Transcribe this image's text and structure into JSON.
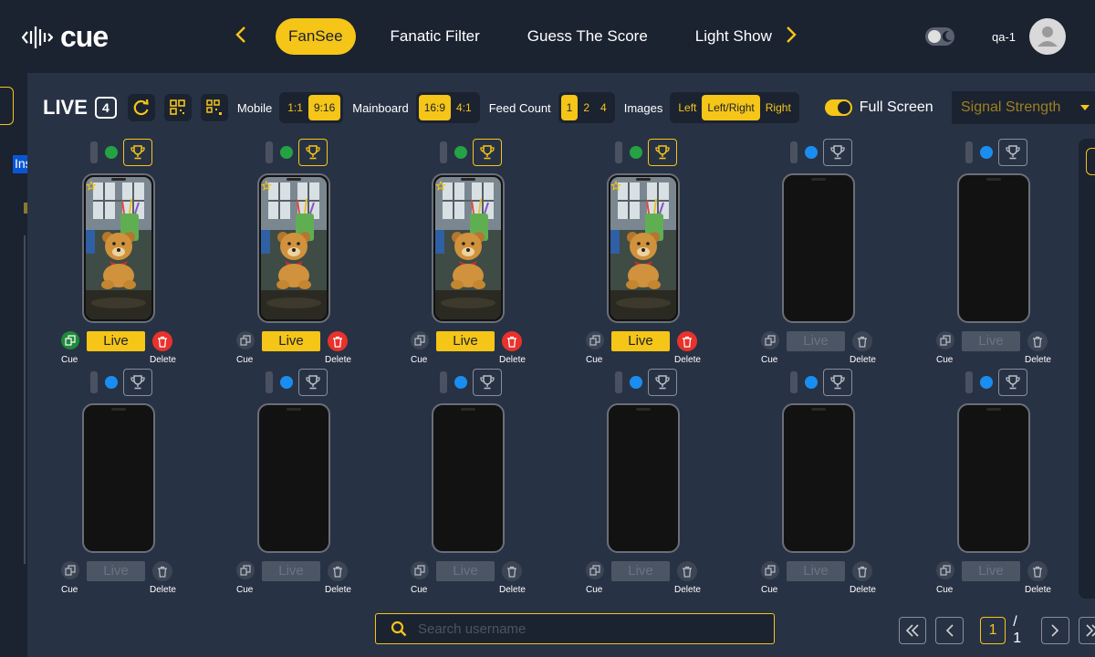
{
  "app": {
    "logo_text": "cue"
  },
  "nav": {
    "tabs": [
      {
        "label": "FanSee",
        "active": true
      },
      {
        "label": "Fanatic Filter",
        "active": false
      },
      {
        "label": "Guess The Score",
        "active": false
      },
      {
        "label": "Light Show",
        "active": false
      }
    ],
    "prev_icon": "chevron-left-icon",
    "next_icon": "chevron-right-icon"
  },
  "user": {
    "name": "qa-1",
    "avatar_icon": "user-avatar-icon",
    "theme_icon": "moon-icon"
  },
  "sidebar": {
    "selected_label": "Ins"
  },
  "toolbar": {
    "title": "LIVE",
    "count": "4",
    "mobile_label": "Mobile",
    "mobile_options": [
      {
        "label": "1:1",
        "active": false
      },
      {
        "label": "9:16",
        "active": true
      }
    ],
    "mainboard_label": "Mainboard",
    "mainboard_options": [
      {
        "label": "16:9",
        "active": true
      },
      {
        "label": "4:1",
        "active": false
      }
    ],
    "feed_count_label": "Feed Count",
    "feed_count_options": [
      {
        "label": "1",
        "active": true
      },
      {
        "label": "2",
        "active": false
      },
      {
        "label": "4",
        "active": false
      }
    ],
    "images_label": "Images",
    "images_options": [
      {
        "label": "Left",
        "active": false
      },
      {
        "label": "Left/Right",
        "active": true
      },
      {
        "label": "Right",
        "active": false
      }
    ],
    "fullscreen_label": "Full Screen",
    "fullscreen_on": true,
    "signal_select": "Signal Strength"
  },
  "cards": [
    {
      "status": "green",
      "trophy_active": true,
      "has_feed": true,
      "live_active": true,
      "cue_active": true,
      "delete_active": true
    },
    {
      "status": "green",
      "trophy_active": true,
      "has_feed": true,
      "live_active": true,
      "cue_active": false,
      "delete_active": true
    },
    {
      "status": "green",
      "trophy_active": true,
      "has_feed": true,
      "live_active": true,
      "cue_active": false,
      "delete_active": true
    },
    {
      "status": "green",
      "trophy_active": true,
      "has_feed": true,
      "live_active": true,
      "cue_active": false,
      "delete_active": true
    },
    {
      "status": "blue",
      "trophy_active": false,
      "has_feed": false,
      "live_active": false,
      "cue_active": false,
      "delete_active": false
    },
    {
      "status": "blue",
      "trophy_active": false,
      "has_feed": false,
      "live_active": false,
      "cue_active": false,
      "delete_active": false
    },
    {
      "status": "blue",
      "trophy_active": false,
      "has_feed": false,
      "live_active": false,
      "cue_active": false,
      "delete_active": false
    },
    {
      "status": "blue",
      "trophy_active": false,
      "has_feed": false,
      "live_active": false,
      "cue_active": false,
      "delete_active": false
    },
    {
      "status": "blue",
      "trophy_active": false,
      "has_feed": false,
      "live_active": false,
      "cue_active": false,
      "delete_active": false
    },
    {
      "status": "blue",
      "trophy_active": false,
      "has_feed": false,
      "live_active": false,
      "cue_active": false,
      "delete_active": false
    },
    {
      "status": "blue",
      "trophy_active": false,
      "has_feed": false,
      "live_active": false,
      "cue_active": false,
      "delete_active": false
    },
    {
      "status": "blue",
      "trophy_active": false,
      "has_feed": false,
      "live_active": false,
      "cue_active": false,
      "delete_active": false
    }
  ],
  "card_labels": {
    "live": "Live",
    "cue": "Cue",
    "delete": "Delete"
  },
  "search": {
    "placeholder": "Search username"
  },
  "pagination": {
    "current": "1",
    "total": "/ 1"
  },
  "colors": {
    "accent": "#f5c518",
    "live_green": "#25a243",
    "idle_blue": "#1a8ef0",
    "delete_red": "#e8322c",
    "panel": "#283245",
    "background": "#1b2230"
  }
}
